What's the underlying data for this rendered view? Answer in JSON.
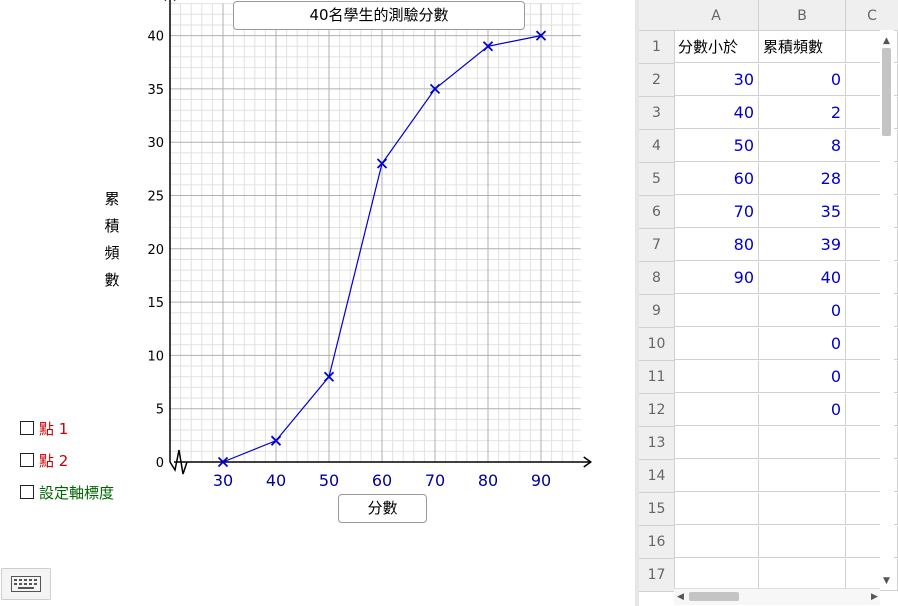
{
  "graph": {
    "title": "40名學生的測驗分數",
    "xlabel": "分數",
    "ylabel": [
      "累",
      "積",
      "頻",
      "數"
    ],
    "checkboxes": [
      {
        "label": "點 1",
        "color": "#cc0000",
        "checked": false
      },
      {
        "label": "點 2",
        "color": "#cc0000",
        "checked": false
      },
      {
        "label": "設定軸標度",
        "color": "#006400",
        "checked": false
      }
    ]
  },
  "chart_data": {
    "type": "line",
    "x": [
      30,
      40,
      50,
      60,
      70,
      80,
      90
    ],
    "y": [
      0,
      2,
      8,
      28,
      35,
      39,
      40
    ],
    "xticks": [
      "30",
      "40",
      "50",
      "60",
      "70",
      "80",
      "90"
    ],
    "yticks": [
      "0",
      "5",
      "10",
      "15",
      "20",
      "25",
      "30",
      "35",
      "40"
    ],
    "xlim": [
      20,
      97.5
    ],
    "ylim": [
      0,
      43
    ],
    "grid": true,
    "marker": "x",
    "line_color": "#0000cc",
    "tick_label_color_x": "#000099"
  },
  "spreadsheet": {
    "columns": [
      "A",
      "B",
      "C"
    ],
    "rows": [
      {
        "num": "1",
        "a": "分數小於",
        "b": "累積頻數"
      },
      {
        "num": "2",
        "a": "30",
        "b": "0"
      },
      {
        "num": "3",
        "a": "40",
        "b": "2"
      },
      {
        "num": "4",
        "a": "50",
        "b": "8"
      },
      {
        "num": "5",
        "a": "60",
        "b": "28"
      },
      {
        "num": "6",
        "a": "70",
        "b": "35"
      },
      {
        "num": "7",
        "a": "80",
        "b": "39"
      },
      {
        "num": "8",
        "a": "90",
        "b": "40"
      },
      {
        "num": "9",
        "a": "",
        "b": "0"
      },
      {
        "num": "10",
        "a": "",
        "b": "0"
      },
      {
        "num": "11",
        "a": "",
        "b": "0"
      },
      {
        "num": "12",
        "a": "",
        "b": "0"
      },
      {
        "num": "13",
        "a": "",
        "b": ""
      },
      {
        "num": "14",
        "a": "",
        "b": ""
      },
      {
        "num": "15",
        "a": "",
        "b": ""
      },
      {
        "num": "16",
        "a": "",
        "b": ""
      },
      {
        "num": "17",
        "a": "",
        "b": ""
      }
    ]
  },
  "icons": {
    "keyboard": "keyboard-icon"
  }
}
